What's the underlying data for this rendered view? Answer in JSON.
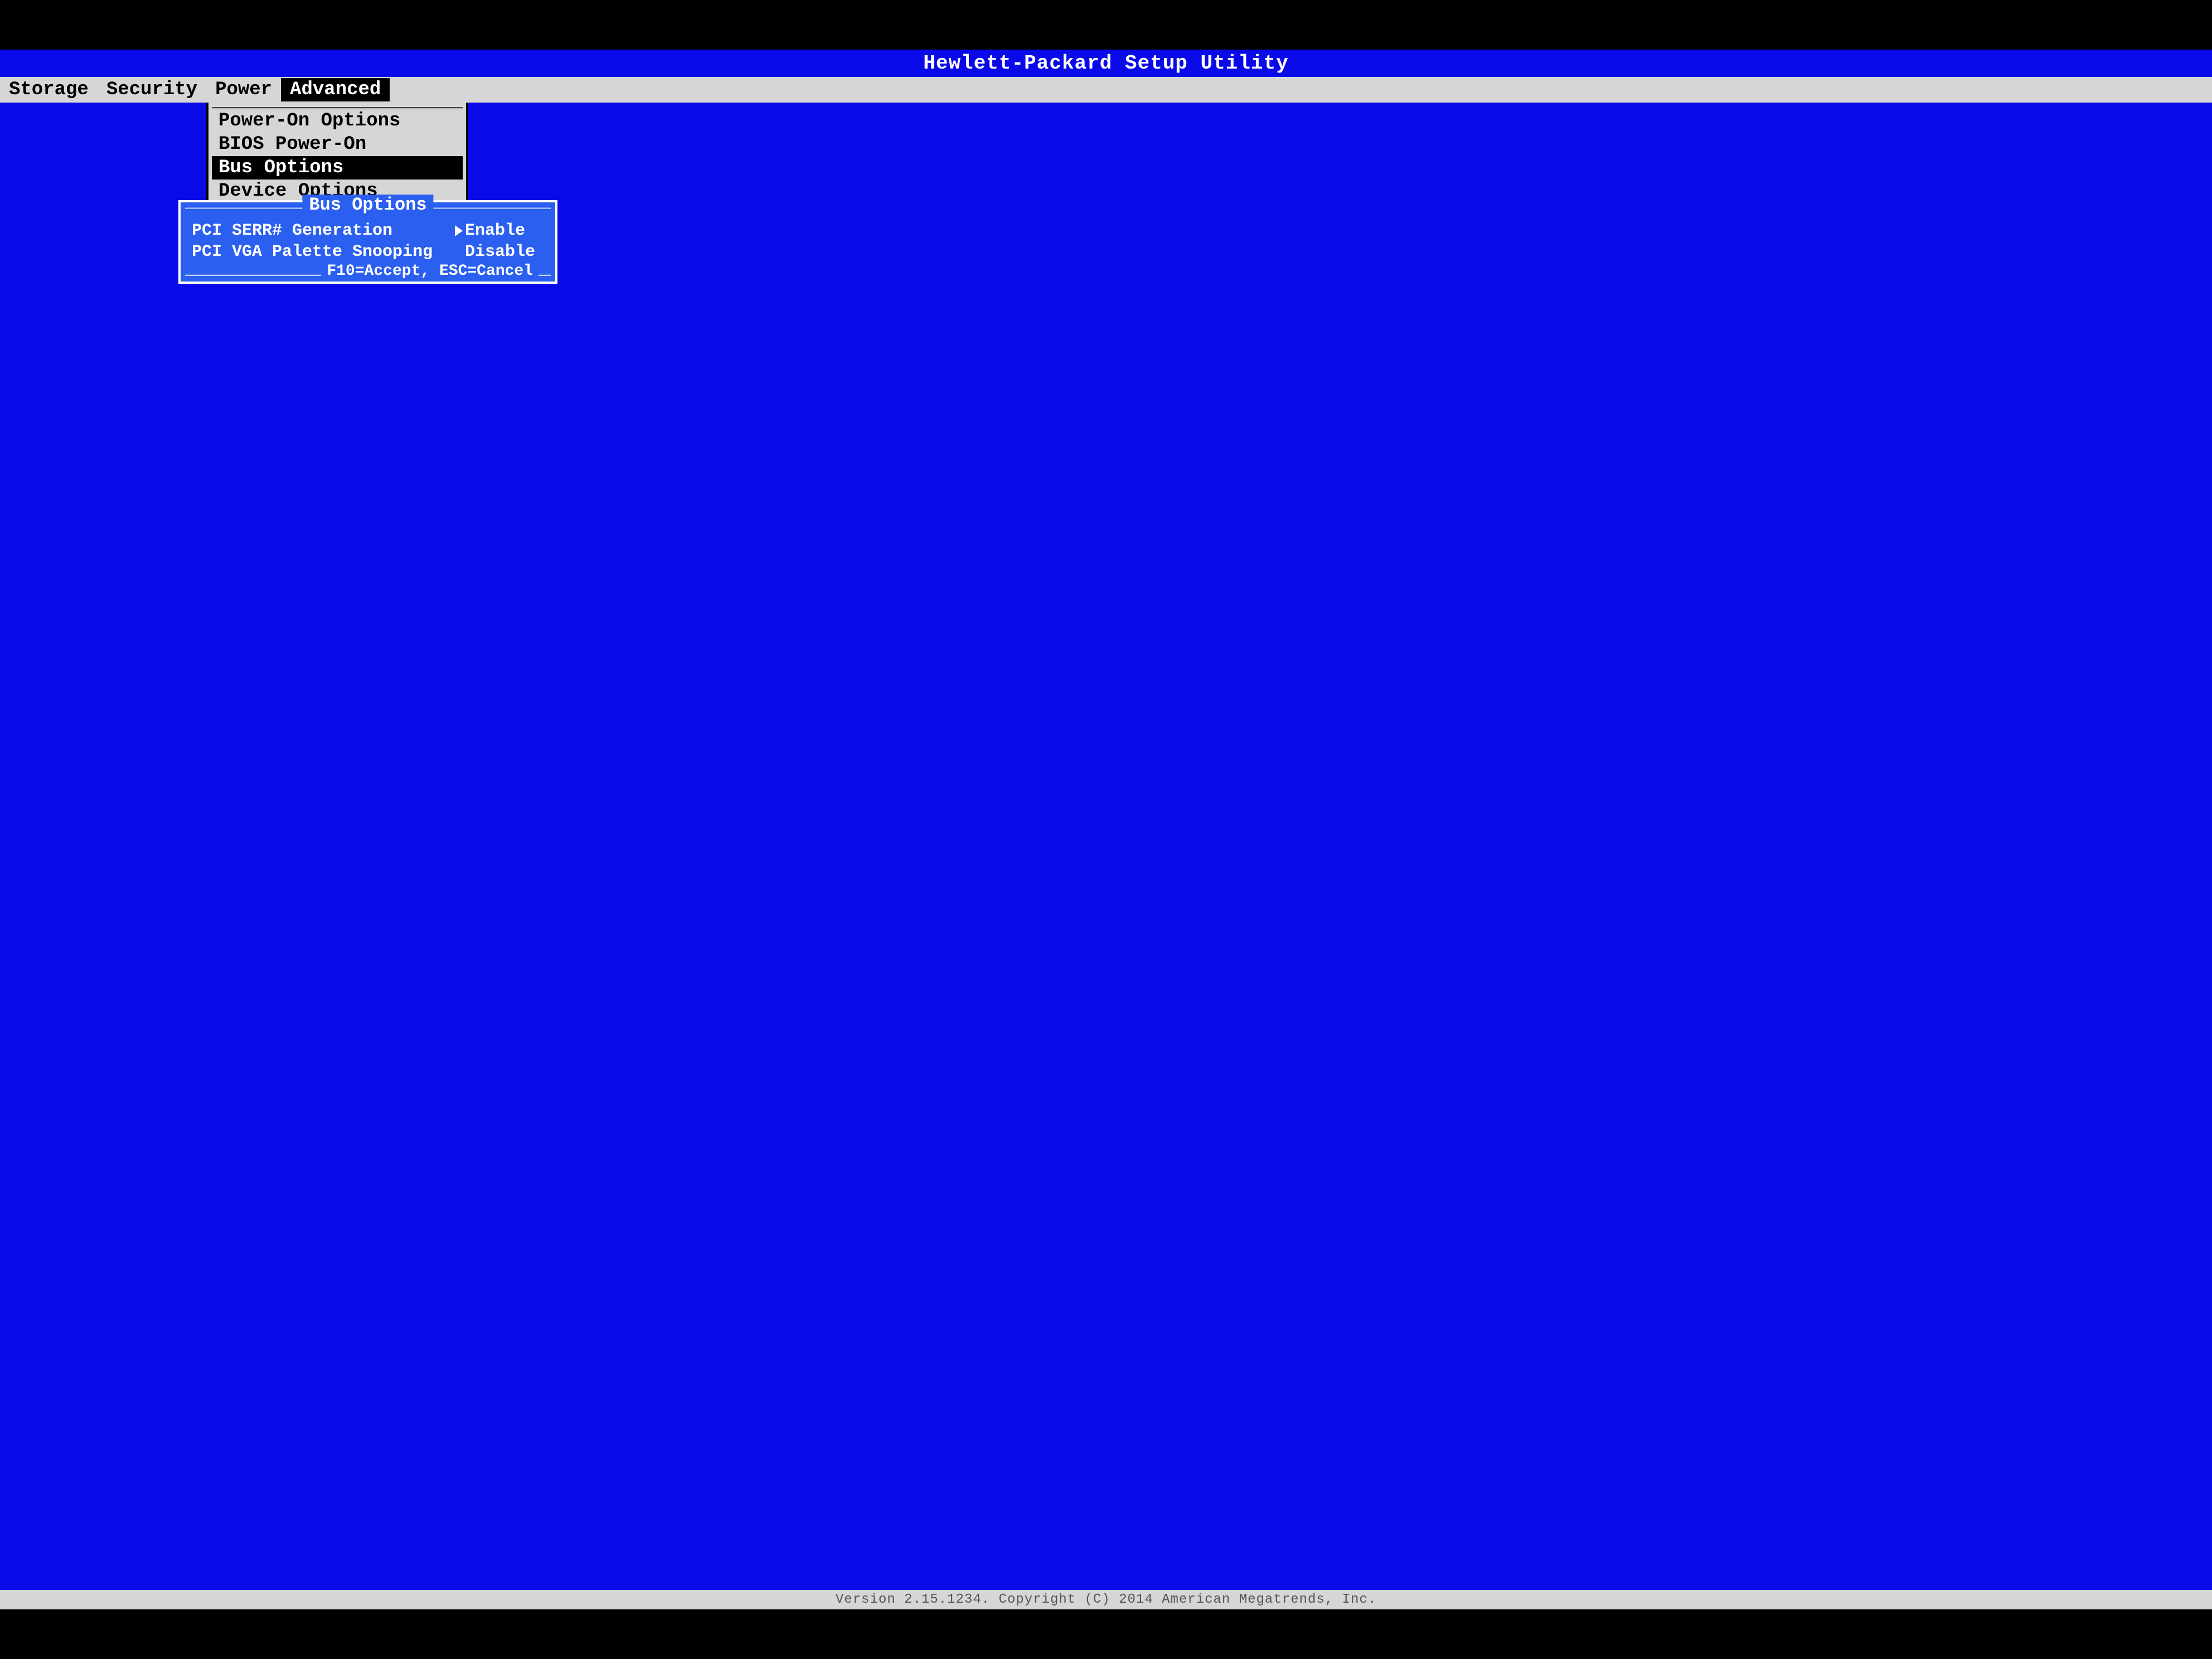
{
  "title": "Hewlett-Packard Setup Utility",
  "menu": {
    "items": [
      "Storage",
      "Security",
      "Power",
      "Advanced"
    ],
    "activeIndex": 3
  },
  "dropdown": {
    "items": [
      "Power-On Options",
      "BIOS Power-On",
      "Bus Options",
      "Device Options"
    ],
    "selectedIndex": 2
  },
  "dialog": {
    "title": "Bus Options",
    "options": [
      {
        "label": "PCI SERR# Generation",
        "value": "Enable",
        "focused": true
      },
      {
        "label": "PCI VGA Palette Snooping",
        "value": "Disable",
        "focused": false
      }
    ],
    "footer": "F10=Accept, ESC=Cancel"
  },
  "status": "Version 2.15.1234. Copyright (C) 2014 American Megatrends, Inc."
}
